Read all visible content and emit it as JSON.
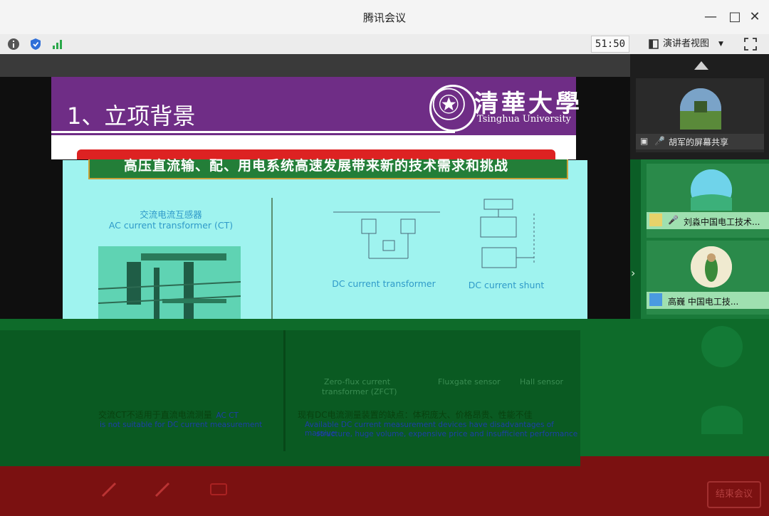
{
  "window": {
    "title": "腾讯会议"
  },
  "toolbar": {
    "timer": "51:50",
    "view_label": "演讲者视图"
  },
  "slide": {
    "heading": "1、立项背景",
    "university_cn": "清華大學",
    "university_en": "Tsinghua University",
    "banner": "高压直流输、配、用电系统高速发展带来新的技术需求和挑战",
    "ac_ct_cn": "交流电流互感器",
    "ac_ct_en": "AC current transformer (CT)",
    "dc_ct_label": "DC current transformer",
    "dc_shunt_label": "DC current shunt",
    "zero_flux": "Zero-flux current",
    "zero_flux_2": "transformer (ZFCT)",
    "fluxgate": "Fluxgate sensor",
    "hall": "Hall sensor",
    "note_left_cn": "交流CT不适用于直流电流测量",
    "note_left_en_a": "AC CT",
    "note_left_en_b": "is not suitable for DC current measurement",
    "note_right_cn": "现有DC电流测量装置的缺点：体积庞大、价格昂贵、性能不佳",
    "note_right_en_a": "Available DC current measurement devices have disadvantages of massive",
    "note_right_en_b": "structure, huge volume, expensive price and insufficient performance"
  },
  "participants": [
    {
      "name": "胡军的屏幕共享"
    },
    {
      "name": "刘淼中国电工技术..."
    },
    {
      "name": "高巍  中国电工技..."
    }
  ],
  "bottom": {
    "end_label": "结束会议"
  },
  "colors": {
    "slide_purple": "#6f2d86",
    "banner_red": "#d22222",
    "bottom_red": "#7b1111",
    "green_band": "#0e6b2a"
  }
}
